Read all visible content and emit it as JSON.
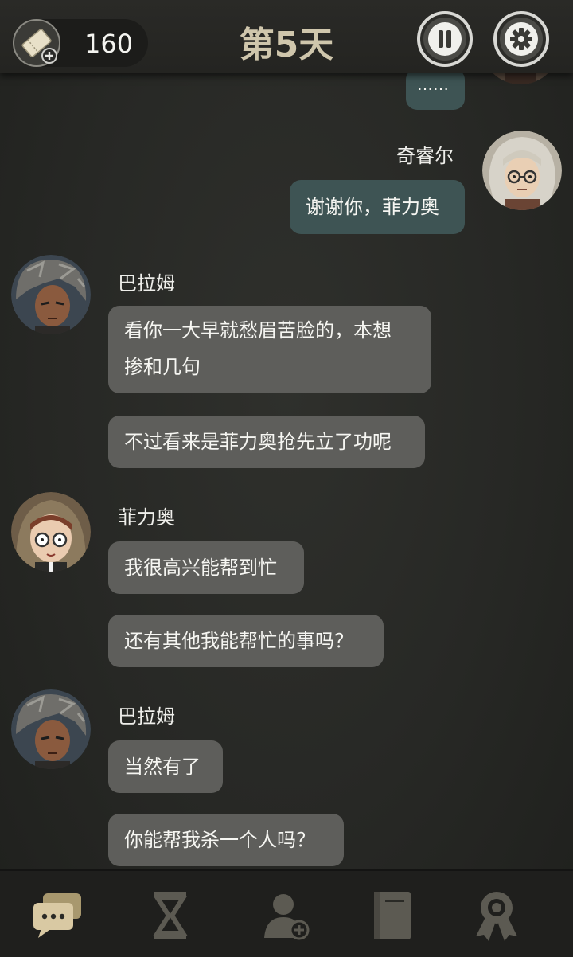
{
  "header": {
    "ticket_count": "160",
    "day_title": "第5天"
  },
  "messages": [
    {
      "side": "right",
      "text": "……"
    },
    {
      "side": "right",
      "sender": "奇睿尔",
      "text": "谢谢你，菲力奥"
    },
    {
      "side": "left",
      "sender": "巴拉姆",
      "text_lines": [
        "看你一大早就愁眉苦脸的，本想",
        "掺和几句"
      ]
    },
    {
      "side": "left",
      "text": "不过看来是菲力奥抢先立了功呢"
    },
    {
      "side": "left",
      "sender": "菲力奥",
      "text": "我很高兴能帮到忙"
    },
    {
      "side": "left",
      "text": "还有其他我能帮忙的事吗？"
    },
    {
      "side": "left",
      "sender": "巴拉姆",
      "text": "当然有了"
    },
    {
      "side": "left",
      "text": "你能帮我杀一个人吗？"
    }
  ],
  "bottom_nav": [
    {
      "icon": "chat-bubbles-icon",
      "active": true
    },
    {
      "icon": "hourglass-icon",
      "active": false
    },
    {
      "icon": "add-person-icon",
      "active": false
    },
    {
      "icon": "book-icon",
      "active": false
    },
    {
      "icon": "award-ribbon-icon",
      "active": false
    }
  ],
  "colors": {
    "active_nav": "#d9c9a3",
    "inactive_nav": "#5c5a52",
    "left_bubble": "#5e5e5b",
    "right_bubble": "#3e5454"
  }
}
